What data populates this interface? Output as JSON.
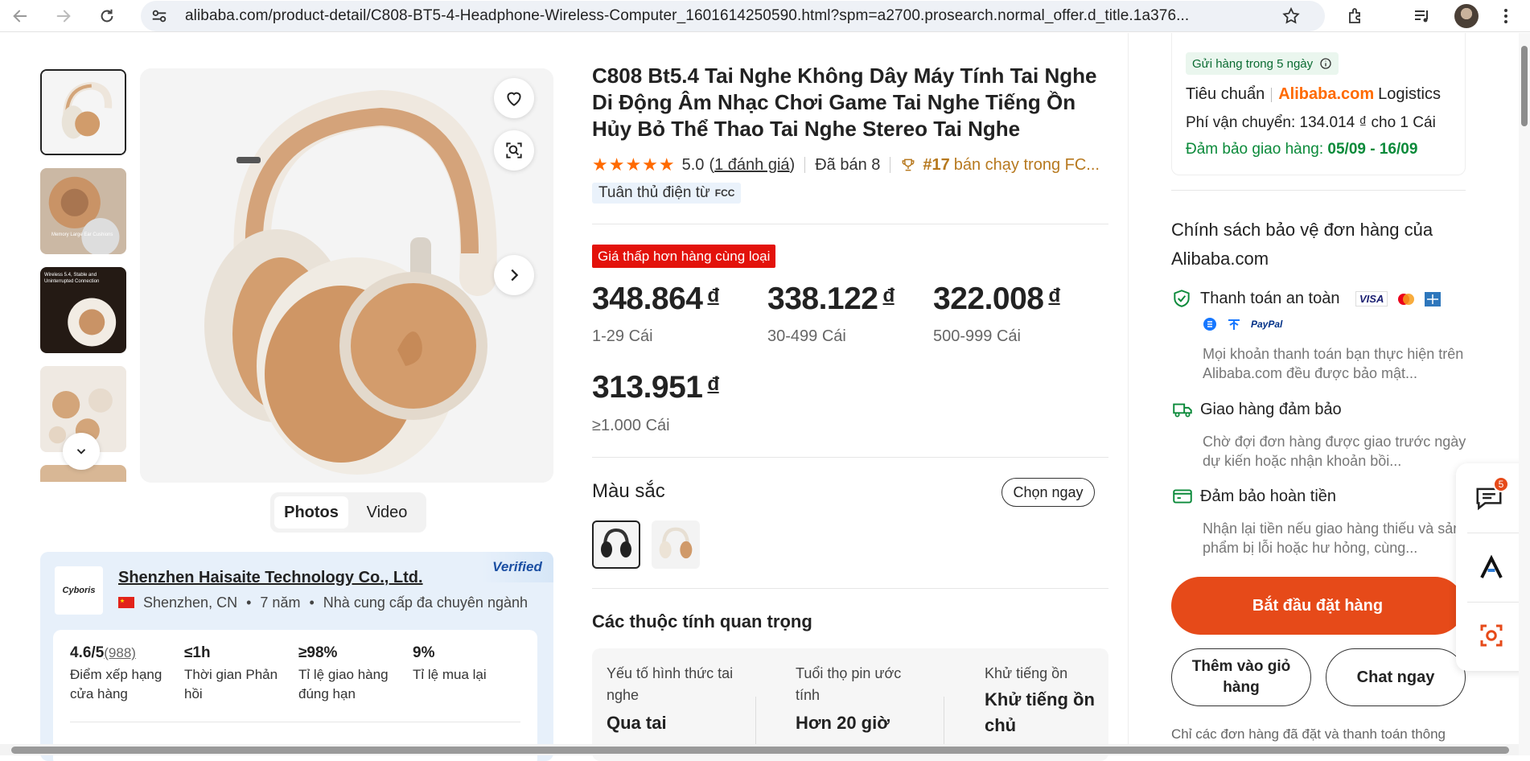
{
  "browser": {
    "url": "alibaba.com/product-detail/C808-BT5-4-Headphone-Wireless-Computer_1601614250590.html?spm=a2700.prosearch.normal_offer.d_title.1a376..."
  },
  "gallery": {
    "thumb_count": 5,
    "tabs": {
      "photos": "Photos",
      "video": "Video"
    },
    "thumb2_text": "Memory Large Ear Cushions",
    "thumb3_text": "Wireless 5.4, Stable and Uninterrupted Connection"
  },
  "supplier": {
    "name": "Shenzhen Haisaite Technology Co., Ltd.",
    "verified": "Verified",
    "logo_text": "Cyboris",
    "location": "Shenzhen, CN",
    "years": "7 năm",
    "type": "Nhà cung cấp đa chuyên ngành",
    "sep": "•",
    "stats": [
      {
        "value": "4.6/5",
        "extra": "(988)",
        "label": "Điểm xếp hạng cửa hàng"
      },
      {
        "value": "≤1h",
        "extra": "",
        "label": "Thời gian Phản hồi"
      },
      {
        "value": "≥98%",
        "extra": "",
        "label": "Tỉ lệ giao hàng đúng hạn"
      },
      {
        "value": "9%",
        "extra": "",
        "label": "Tỉ lệ mua lại"
      }
    ]
  },
  "product": {
    "title": "C808 Bt5.4 Tai Nghe Không Dây Máy Tính Tai Nghe Di Động Âm Nhạc Chơi Game Tai Nghe Tiếng Ồn Hủy Bỏ Thể Thao Tai Nghe Stereo Tai Nghe",
    "rating_value": 5.0,
    "rating": "5.0",
    "reviews": "1 đánh giá",
    "sold": "Đã bán 8",
    "rank": "#17",
    "rank_text": "bán chạy trong FC...",
    "compliance": "Tuân thủ điện từ",
    "compliance_badge": "FCC",
    "promo_badge": "Giá thấp hơn hàng cùng loại",
    "currency": "đ",
    "prices": [
      {
        "price": "348.864",
        "qty": "1-29 Cái"
      },
      {
        "price": "338.122",
        "qty": "30-499 Cái"
      },
      {
        "price": "322.008",
        "qty": "500-999 Cái"
      },
      {
        "price": "313.951",
        "qty": "≥1.000 Cái"
      }
    ],
    "color_label": "Màu sắc",
    "choose_now": "Chọn ngay",
    "attributes_title": "Các thuộc tính quan trọng",
    "attributes": [
      {
        "name": "Yếu tố hình thức tai nghe",
        "value": "Qua tai"
      },
      {
        "name": "Tuổi thọ pin ước tính",
        "value": "Hơn 20 giờ"
      },
      {
        "name": "Khử tiếng ồn",
        "value": "Khử tiếng ồn chủ"
      }
    ]
  },
  "shipping": {
    "ship_badge": "Gửi hàng trong 5 ngày",
    "standard": "Tiêu chuẩn",
    "logistics_brand": "Alibaba.com",
    "logistics": "Logistics",
    "fee": "Phí vận chuyển: 134.014 ₫ cho 1 Cái",
    "guarantee_label": "Đảm bảo giao hàng:",
    "guarantee_dates": "05/09 - 16/09"
  },
  "protection": {
    "title": "Chính sách bảo vệ đơn hàng của Alibaba.com",
    "items": [
      {
        "title": "Thanh toán an toàn",
        "desc": "Mọi khoản thanh toán bạn thực hiện trên Alibaba.com đều được bảo mật..."
      },
      {
        "title": "Giao hàng đảm bảo",
        "desc": "Chờ đợi đơn hàng được giao trước ngày dự kiến hoặc nhận khoản bồi..."
      },
      {
        "title": "Đảm bảo hoàn tiền",
        "desc": "Nhận lại tiền nếu giao hàng thiếu và sản phẩm bị lỗi hoặc hư hỏng, cùng..."
      }
    ],
    "payment_visa": "VISA",
    "payment_paypal": "PayPal"
  },
  "actions": {
    "order": "Bắt đầu đặt hàng",
    "cart": "Thêm vào giỏ hàng",
    "chat": "Chat ngay",
    "footnote": "Chỉ các đơn hàng đã đặt và thanh toán thông"
  },
  "floating": {
    "messages_badge": "5"
  },
  "colors": {
    "orange": "#e64a19",
    "red_badge": "#e3120b",
    "green": "#0b8a3a",
    "brand_orange": "#ff6a00",
    "star": "#ff6a00"
  }
}
